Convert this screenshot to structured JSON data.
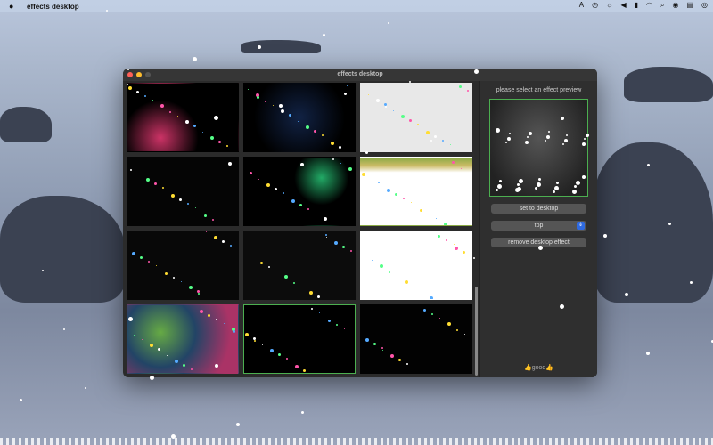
{
  "menubar": {
    "app_name": "effects desktop",
    "status_icons": [
      "keyboard-input-icon",
      "time-machine-icon",
      "brightness-icon",
      "volume-icon",
      "battery-icon",
      "wifi-icon",
      "search-icon",
      "user-icon",
      "control-center-icon",
      "siri-icon"
    ]
  },
  "window": {
    "title": "effects desktop"
  },
  "effects": [
    {
      "name": "confetti-bokeh",
      "bg": "radial-gradient(circle at 30% 80%,#c36 0,#000 40%),linear-gradient(#3a3,#000)"
    },
    {
      "name": "symbols",
      "bg": "radial-gradient(circle at 50% 50%,#124 0,#000 70%)"
    },
    {
      "name": "white-paper",
      "bg": "#e8e8e8"
    },
    {
      "name": "bubbles",
      "bg": "#050505"
    },
    {
      "name": "fireworks",
      "bg": "radial-gradient(circle at 70% 30%,#2a6 0,#000 30%),radial-gradient(circle at 40% 70%,#28a 0,#000 30%)"
    },
    {
      "name": "leaves",
      "bg": "linear-gradient(#8a4 0,#cb6 12%,#fff 22%)"
    },
    {
      "name": "rings",
      "bg": "#080808"
    },
    {
      "name": "stars",
      "bg": "#0c0c0c"
    },
    {
      "name": "colored-rings",
      "bg": "#fff"
    },
    {
      "name": "color-bokeh",
      "bg": "radial-gradient(circle at 30% 40%,#6a4,#246 40%,#a36 80%)"
    },
    {
      "name": "snow",
      "bg": "#000"
    },
    {
      "name": "colored-dots",
      "bg": "#020202"
    }
  ],
  "selected_index": 10,
  "panel": {
    "prompt": "please select an effect preview",
    "set_button": "set to desktop",
    "position_select": "top",
    "remove_button": "remove desktop effect",
    "footer": "👍good👍"
  }
}
